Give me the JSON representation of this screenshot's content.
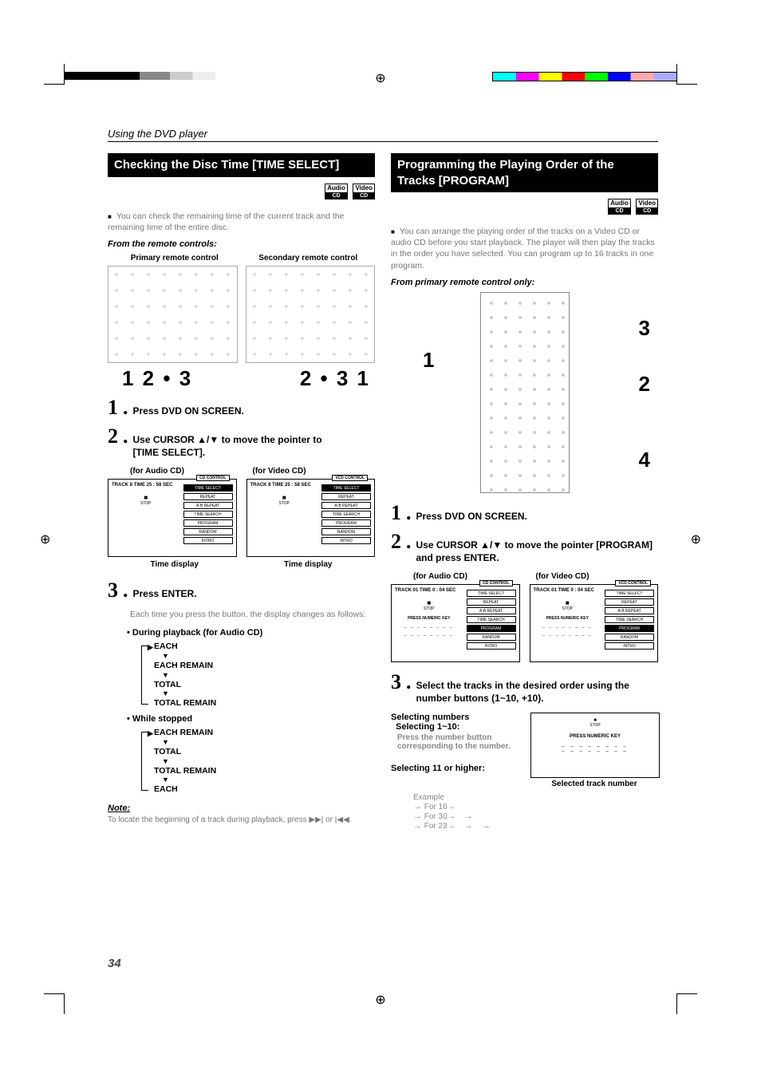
{
  "header": {
    "section": "Using the DVD player"
  },
  "left": {
    "title": "Checking the Disc Time [TIME SELECT]",
    "badges": [
      "Audio CD",
      "Video CD"
    ],
    "intro": "You can check the remaining time of the current track and the remaining time of the entire disc.",
    "from": "From the remote controls:",
    "primary_label": "Primary remote control",
    "secondary_label": "Secondary remote control",
    "stepnums_left": "1   2 • 3",
    "stepnums_right": "2 • 3        1",
    "step1": "Press DVD ON SCREEN.",
    "step2_a": "Use CURSOR ▲/▼ to move the pointer to",
    "step2_b": "[TIME SELECT].",
    "for_audio": "(for Audio CD)",
    "for_video": "(for Video CD)",
    "osd_tab_cd": "CD CONTROL",
    "osd_tab_vcd": "VCD CONTROL",
    "osd_track": "TRACK   8  TIME 25 : 58 SEC",
    "osd_stop": "STOP",
    "osd_menu": [
      "TIME SELECT",
      "REPEAT",
      "A-B REPEAT",
      "TIME SEARCH",
      "PROGRAM",
      "RANDOM",
      "INTRO"
    ],
    "time_display": "Time display",
    "step3": "Press ENTER.",
    "step3_note": "Each time you press the button, the display changes as follows:",
    "sub1": "During playback (for Audio CD)",
    "flow1": [
      "EACH",
      "EACH REMAIN",
      "TOTAL",
      "TOTAL REMAIN"
    ],
    "sub2": "While stopped",
    "flow2": [
      "EACH REMAIN",
      "TOTAL",
      "TOTAL REMAIN",
      "EACH"
    ],
    "note_hdr": "Note:",
    "note_body": "To locate the beginning of a track during playback, press ▶▶| or |◀◀."
  },
  "right": {
    "title": "Programming the Playing Order of the Tracks [PROGRAM]",
    "badges": [
      "Audio CD",
      "Video CD"
    ],
    "intro": "You can arrange the playing order of the tracks on a Video CD or audio CD before you start playback. The player will then play the tracks in the order you have selected. You can program up to 16 tracks in one program.",
    "from": "From primary remote control only:",
    "callouts": {
      "c1": "1",
      "c2": "2",
      "c3": "3",
      "c4": "4"
    },
    "step1": "Press DVD ON SCREEN.",
    "step2": "Use CURSOR ▲/▼ to move the pointer [PROGRAM] and press ENTER.",
    "for_audio": "(for Audio CD)",
    "for_video": "(for Video CD)",
    "osd_tab_cd": "CD CONTROL",
    "osd_tab_vcd": "VCD CONTROL",
    "osd_track": "TRACK  01  TIME  0 : 04 SEC",
    "osd_stop": "STOP",
    "osd_press": "PRESS NUMERIC KEY",
    "osd_slots": "_  _  _  _  _  _  _  _",
    "osd_menu": [
      "TIME SELECT",
      "REPEAT",
      "A-B REPEAT",
      "TIME SEARCH",
      "PROGRAM",
      "RANDOM",
      "INTRO"
    ],
    "step3": "Select the tracks in the desired order using the number buttons (1~10, +10).",
    "sel_heading": "Selecting numbers",
    "sel_110": "Selecting 1~10:",
    "sel_110_note": "Press the number button corresponding to the number.",
    "sel_11": "Selecting 11 or higher:",
    "sel_caption": "Selected track number",
    "ex_label": "Example",
    "ex16": "For 16→",
    "ex30": "For 30→",
    "ex23": "For 23→"
  },
  "page_number": "34",
  "reg_symbol": "⊕"
}
